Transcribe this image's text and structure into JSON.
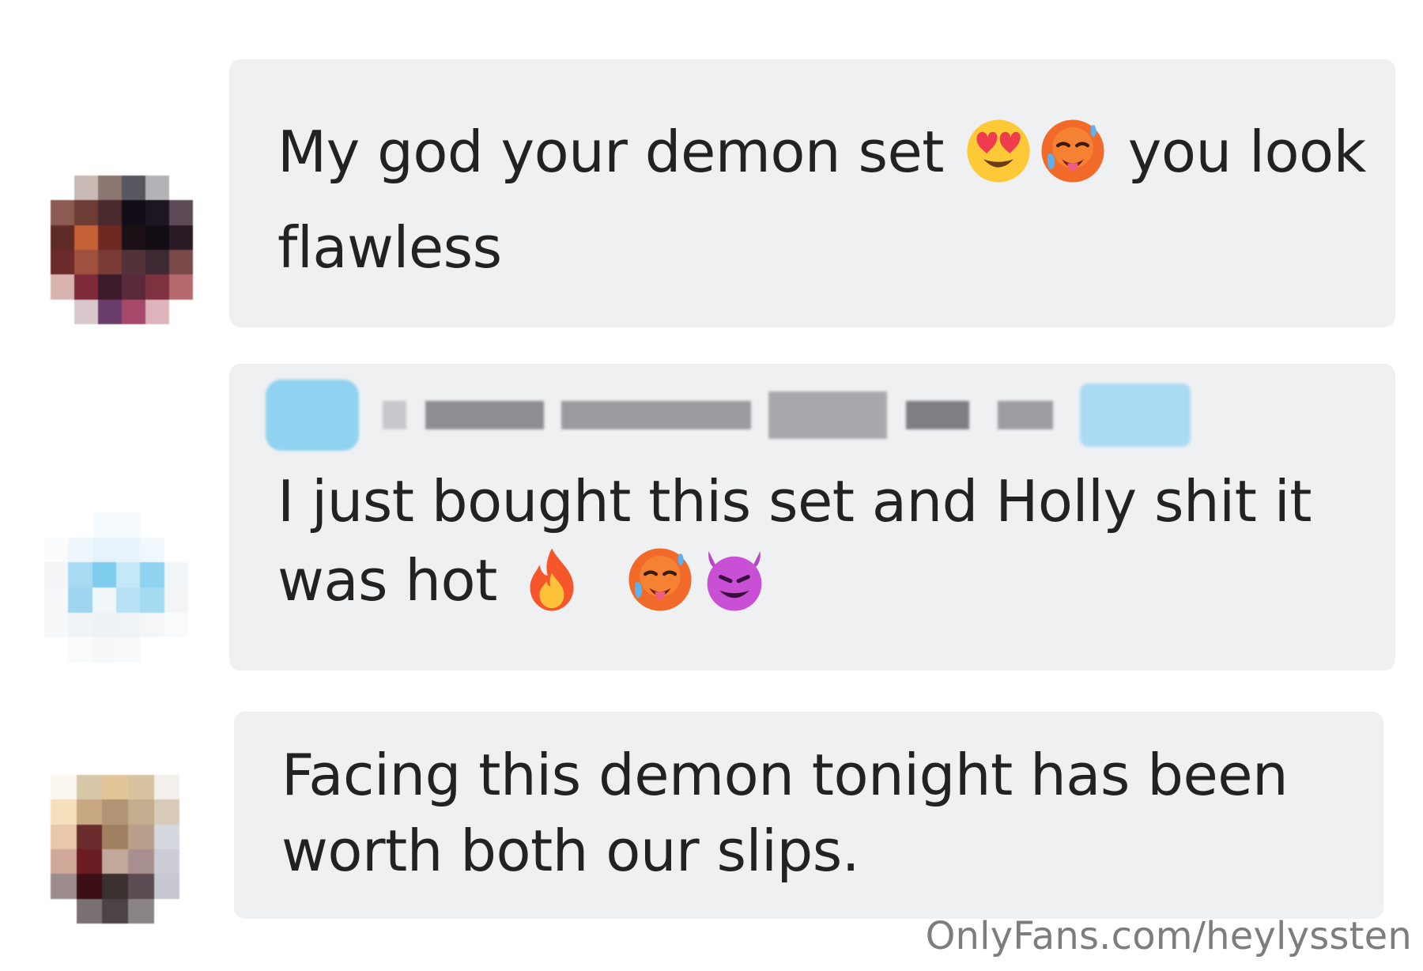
{
  "comments": [
    {
      "text": "My god your demon set 😍🥵 you look flawless",
      "emojis": [
        "heart-eyes-face",
        "hot-face"
      ]
    },
    {
      "text": "I just bought this set and Holly shit it was hot 🔥 🥵😈",
      "emojis": [
        "fire",
        "hot-face",
        "smiling-devil"
      ]
    },
    {
      "text": "Facing this demon tonight has been worth both our slips."
    }
  ],
  "watermark": "OnlyFans.com/heylyssten",
  "colors": {
    "bubble": "#eff0f2",
    "text": "#222222",
    "watermark": "#7d7d7d"
  }
}
